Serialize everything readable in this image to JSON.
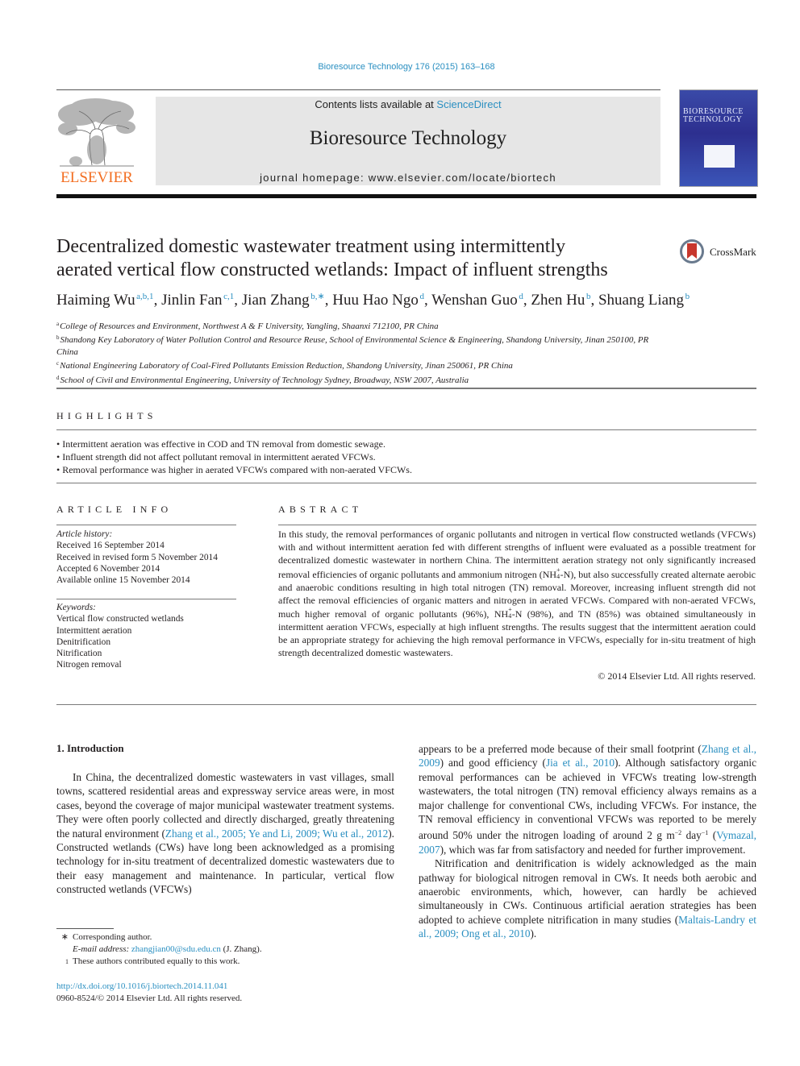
{
  "header": {
    "journal_ref": "Bioresource Technology 176 (2015) 163–168",
    "contents_prefix": "Contents lists available at ",
    "contents_link": "ScienceDirect",
    "journal_title": "Bioresource Technology",
    "homepage_line": "journal homepage: www.elsevier.com/locate/biortech",
    "publisher_logo_text": "ELSEVIER",
    "cover_title_line1": "BIORESOURCE",
    "cover_title_line2": "TECHNOLOGY"
  },
  "article": {
    "title_line1": "Decentralized domestic wastewater treatment using intermittently",
    "title_line2": "aerated vertical flow constructed wetlands: Impact of influent strengths",
    "crossmark_label": "CrossMark",
    "authors": [
      {
        "name": "Haiming Wu",
        "sup": "a,b,1"
      },
      {
        "name": "Jinlin Fan",
        "sup": "c,1"
      },
      {
        "name": "Jian Zhang",
        "sup": "b,∗"
      },
      {
        "name": "Huu Hao Ngo",
        "sup": "d"
      },
      {
        "name": "Wenshan Guo",
        "sup": "d"
      },
      {
        "name": "Zhen Hu",
        "sup": "b"
      },
      {
        "name": "Shuang Liang",
        "sup": "b"
      }
    ],
    "affiliations": [
      {
        "mark": "a",
        "text": "College of Resources and Environment, Northwest A & F University, Yangling, Shaanxi 712100, PR China"
      },
      {
        "mark": "b",
        "text": "Shandong Key Laboratory of Water Pollution Control and Resource Reuse, School of Environmental Science & Engineering, Shandong University, Jinan 250100, PR China"
      },
      {
        "mark": "c",
        "text": "National Engineering Laboratory of Coal-Fired Pollutants Emission Reduction, Shandong University, Jinan 250061, PR China"
      },
      {
        "mark": "d",
        "text": "School of Civil and Environmental Engineering, University of Technology Sydney, Broadway, NSW 2007, Australia"
      }
    ]
  },
  "highlights": {
    "heading": "HIGHLIGHTS",
    "items": [
      "Intermittent aeration was effective in COD and TN removal from domestic sewage.",
      "Influent strength did not affect pollutant removal in intermittent aerated VFCWs.",
      "Removal performance was higher in aerated VFCWs compared with non-aerated VFCWs."
    ]
  },
  "article_info": {
    "heading": "ARTICLE INFO",
    "history_label": "Article history:",
    "history": [
      "Received 16 September 2014",
      "Received in revised form 5 November 2014",
      "Accepted 6 November 2014",
      "Available online 15 November 2014"
    ],
    "keywords_label": "Keywords:",
    "keywords": [
      "Vertical flow constructed wetlands",
      "Intermittent aeration",
      "Denitrification",
      "Nitrification",
      "Nitrogen removal"
    ]
  },
  "abstract": {
    "heading": "ABSTRACT",
    "part1": "In this study, the removal performances of organic pollutants and nitrogen in vertical flow constructed wetlands (VFCWs) with and without intermittent aeration fed with different strengths of influent were evaluated as a possible treatment for decentralized domestic wastewater in northern China. The intermittent aeration strategy not only significantly increased removal efficiencies of organic pollutants and ammonium nitrogen (NH",
    "part2": "-N), but also successfully created alternate aerobic and anaerobic conditions resulting in high total nitrogen (TN) removal. Moreover, increasing influent strength did not affect the removal efficiencies of organic matters and nitrogen in aerated VFCWs. Compared with non-aerated VFCWs, much higher removal of organic pollutants (96%), NH",
    "part3": "-N (98%), and TN (85%) was obtained simultaneously in intermittent aeration VFCWs, especially at high influent strengths. The results suggest that the intermittent aeration could be an appropriate strategy for achieving the high removal performance in VFCWs, especially for in-situ treatment of high strength decentralized domestic wastewaters.",
    "nh4_sup": "+",
    "nh4_sub": "4",
    "copyright": "© 2014 Elsevier Ltd. All rights reserved."
  },
  "body": {
    "intro_heading": "1. Introduction",
    "left_p1_a": "In China, the decentralized domestic wastewaters in vast villages, small towns, scattered residential areas and expressway service areas were, in most cases, beyond the coverage of major municipal wastewater treatment systems. They were often poorly collected and directly discharged, greatly threatening the natural environment (",
    "left_p1_cite": "Zhang et al., 2005; Ye and Li, 2009; Wu et al., 2012",
    "left_p1_b": "). Constructed wetlands (CWs) have long been acknowledged as a promising technology for in-situ treatment of decentralized domestic wastewaters due to their easy management and maintenance. In particular, vertical flow constructed wetlands (VFCWs)",
    "right_p1_a": "appears to be a preferred mode because of their small footprint (",
    "right_p1_cite1": "Zhang et al., 2009",
    "right_p1_b": ") and good efficiency (",
    "right_p1_cite2": "Jia et al., 2010",
    "right_p1_c": "). Although satisfactory organic removal performances can be achieved in VFCWs treating low-strength wastewaters, the total nitrogen (TN) removal efficiency always remains as a major challenge for conventional CWs, including VFCWs. For instance, the TN removal efficiency in conventional VFCWs was reported to be merely around 50% under the nitrogen loading of around 2 g m",
    "right_p1_sup1": "−2",
    "right_p1_d": " day",
    "right_p1_sup2": "−1",
    "right_p1_e": " (",
    "right_p1_cite3": "Vymazal, 2007",
    "right_p1_f": "), which was far from satisfactory and needed for further improvement.",
    "right_p2_a": "Nitrification and denitrification is widely acknowledged as the main pathway for biological nitrogen removal in CWs. It needs both aerobic and anaerobic environments, which, however, can hardly be achieved simultaneously in CWs. Continuous artificial aeration strategies has been adopted to achieve complete nitrification in many studies (",
    "right_p2_cite": "Maltais-Landry et al., 2009; Ong et al., 2010",
    "right_p2_b": ")."
  },
  "footnotes": {
    "corresponding_mark": "∗",
    "corresponding_text": "Corresponding author.",
    "email_label": "E-mail address:",
    "email": "zhangjian00@sdu.edu.cn",
    "email_suffix": " (J. Zhang).",
    "equal_mark": "1",
    "equal_text": "These authors contributed equally to this work.",
    "doi": "http://dx.doi.org/10.1016/j.biortech.2014.11.041",
    "issn_line": "0960-8524/© 2014 Elsevier Ltd. All rights reserved."
  }
}
